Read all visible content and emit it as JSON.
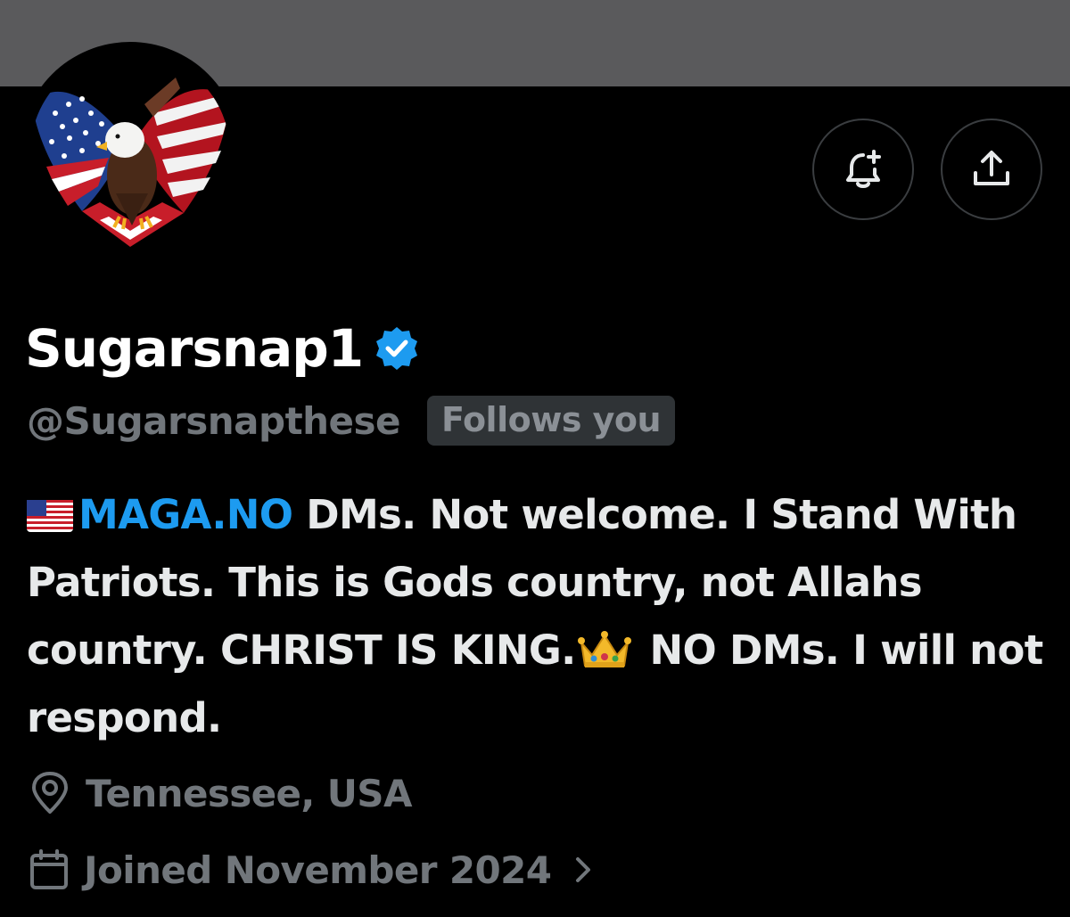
{
  "profile": {
    "display_name": "Sugarsnap1",
    "handle": "@Sugarsnapthese",
    "follows_you": "Follows you",
    "verified_icon": "verified-badge-icon",
    "avatar": "bald-eagle-american-flag-wings"
  },
  "bio": {
    "prefix_emoji": "🇺🇸",
    "link_text": "MAGA.NO",
    "text_part1": " DMs. Not welcome. I Stand With Patriots. This is Gods country, not Allahs country. CHRIST IS KING.",
    "crown_emoji": "👑",
    "text_part2": " NO DMs. I will not respond."
  },
  "meta": {
    "location": "Tennessee, USA",
    "location_icon": "location-pin-icon",
    "joined": "Joined November 2024",
    "calendar_icon": "calendar-icon",
    "chevron_icon": "chevron-right-icon"
  },
  "actions": {
    "notify_icon": "bell-plus-icon",
    "share_icon": "share-icon"
  },
  "colors": {
    "background": "#000000",
    "banner": "#5a5a5c",
    "primary_text": "#e7e9ea",
    "secondary_text": "#71767b",
    "link": "#1d9bf0",
    "verified": "#1d9bf0",
    "badge_bg": "#2f3336"
  }
}
